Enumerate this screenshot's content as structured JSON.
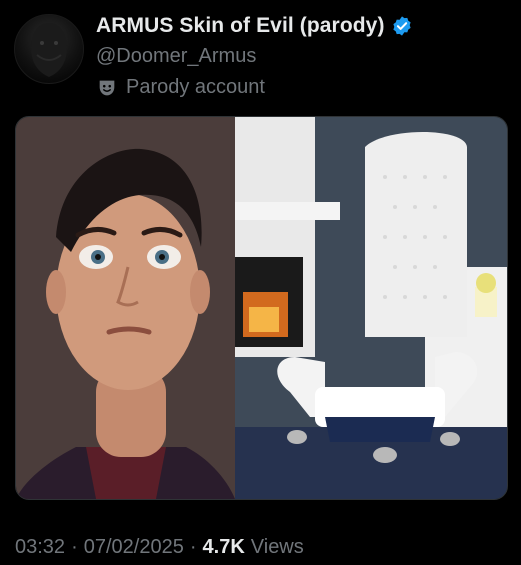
{
  "tweet": {
    "display_name": "ARMUS Skin of Evil (parody)",
    "handle": "@Doomer_Armus",
    "parody_label": "Parody account",
    "media": {
      "left_image": "man-surprised-face",
      "right_image": "white-tufted-throne-chair"
    },
    "meta": {
      "time": "03:32",
      "sep1": "·",
      "date": "07/02/2025",
      "sep2": "·",
      "views_count": "4.7K",
      "views_label": "Views"
    }
  },
  "colors": {
    "background": "#000000",
    "primary_text": "#e7e9ea",
    "secondary_text": "#71767b",
    "verified_blue": "#1d9bf0"
  },
  "icons": [
    "avatar",
    "verified-badge-icon",
    "parody-mask-icon"
  ]
}
